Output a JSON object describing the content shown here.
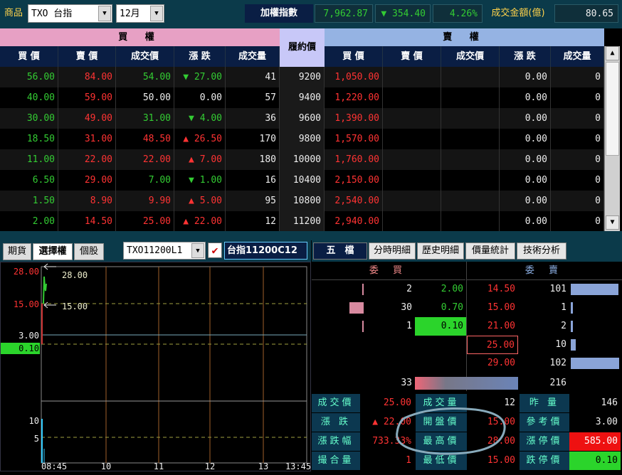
{
  "topbar": {
    "product_label": "商品",
    "product_value": "TXO 台指",
    "month_value": "12月",
    "index_label": "加權指數",
    "index_value": "7,962.87",
    "index_change": "▼ 354.40",
    "index_pct": "4.26%",
    "volume_label": "成交金額(億)",
    "volume_value": "80.65"
  },
  "table": {
    "buy_header": "買 權",
    "sell_header": "賣 權",
    "strike_header": "履約價",
    "columns": [
      "買 價",
      "賣 價",
      "成交價",
      "漲 跌",
      "成交量"
    ],
    "rows": [
      {
        "c_bid": "56.00",
        "c_ask": "84.00",
        "c_last": "54.00",
        "c_chg_dir": "down",
        "c_chg": "27.00",
        "c_vol": "41",
        "strike": "9200",
        "p_bid": "1,050.00",
        "p_ask": "",
        "p_last": "",
        "p_chg": "0.00",
        "p_vol": "0"
      },
      {
        "c_bid": "40.00",
        "c_ask": "59.00",
        "c_last": "50.00",
        "c_chg_dir": "none",
        "c_chg": "0.00",
        "c_vol": "57",
        "strike": "9400",
        "p_bid": "1,220.00",
        "p_ask": "",
        "p_last": "",
        "p_chg": "0.00",
        "p_vol": "0"
      },
      {
        "c_bid": "30.00",
        "c_ask": "49.00",
        "c_last": "31.00",
        "c_chg_dir": "down",
        "c_chg": "4.00",
        "c_vol": "36",
        "strike": "9600",
        "p_bid": "1,390.00",
        "p_ask": "",
        "p_last": "",
        "p_chg": "0.00",
        "p_vol": "0"
      },
      {
        "c_bid": "18.50",
        "c_ask": "31.00",
        "c_last": "48.50",
        "c_chg_dir": "up",
        "c_chg": "26.50",
        "c_vol": "170",
        "strike": "9800",
        "p_bid": "1,570.00",
        "p_ask": "",
        "p_last": "",
        "p_chg": "0.00",
        "p_vol": "0"
      },
      {
        "c_bid": "11.00",
        "c_ask": "22.00",
        "c_last": "22.00",
        "c_chg_dir": "up",
        "c_chg": "7.00",
        "c_vol": "180",
        "strike": "10000",
        "p_bid": "1,760.00",
        "p_ask": "",
        "p_last": "",
        "p_chg": "0.00",
        "p_vol": "0"
      },
      {
        "c_bid": "6.50",
        "c_ask": "29.00",
        "c_last": "7.00",
        "c_chg_dir": "down",
        "c_chg": "1.00",
        "c_vol": "16",
        "strike": "10400",
        "p_bid": "2,150.00",
        "p_ask": "",
        "p_last": "",
        "p_chg": "0.00",
        "p_vol": "0"
      },
      {
        "c_bid": "1.50",
        "c_ask": "8.90",
        "c_last": "9.90",
        "c_chg_dir": "up",
        "c_chg": "5.00",
        "c_vol": "95",
        "strike": "10800",
        "p_bid": "2,540.00",
        "p_ask": "",
        "p_last": "",
        "p_chg": "0.00",
        "p_vol": "0"
      },
      {
        "c_bid": "2.00",
        "c_ask": "14.50",
        "c_last": "25.00",
        "c_chg_dir": "up",
        "c_chg": "22.00",
        "c_vol": "12",
        "strike": "11200",
        "p_bid": "2,940.00",
        "p_ask": "",
        "p_last": "",
        "p_chg": "0.00",
        "p_vol": "0"
      }
    ]
  },
  "left_tabs": [
    "期貨",
    "選擇權",
    "個股"
  ],
  "left_tab_active": 1,
  "symbol_select": "TXO11200L1",
  "symbol_name": "台指11200C12",
  "right_tabs": [
    "五　檔",
    "分時明細",
    "歷史明細",
    "價量統計",
    "技術分析"
  ],
  "chart": {
    "y_labels": [
      "28.00",
      "15.00",
      "3.00",
      "0.10",
      "10",
      "5"
    ],
    "annotations": [
      "28.00",
      "15.00"
    ],
    "x_labels": [
      "08:45",
      "10",
      "11",
      "12",
      "13",
      "13:45"
    ]
  },
  "five": {
    "bid_header": "委 買",
    "ask_header": "委 賣",
    "levels": [
      {
        "bid_qty": "2",
        "bid_px": "2.00",
        "ask_px": "14.50",
        "ask_qty": "101"
      },
      {
        "bid_qty": "30",
        "bid_px": "0.70",
        "ask_px": "15.00",
        "ask_qty": "1"
      },
      {
        "bid_qty": "1",
        "bid_px": "0.10",
        "ask_px": "21.00",
        "ask_qty": "2"
      },
      {
        "bid_qty": "",
        "bid_px": "",
        "ask_px": "25.00",
        "ask_qty": "10"
      },
      {
        "bid_qty": "",
        "bid_px": "",
        "ask_px": "29.00",
        "ask_qty": "102"
      }
    ],
    "bid_total": "33",
    "ask_total": "216",
    "stats": [
      {
        "l1": "成交價",
        "v1": "25.00",
        "l2": "成交量",
        "v2": "12",
        "l3": "昨 量",
        "v3": "146"
      },
      {
        "l1": "漲 跌",
        "v1": "▲ 22.00",
        "l2": "開盤價",
        "v2": "15.00",
        "l3": "參考價",
        "v3": "3.00"
      },
      {
        "l1": "漲跌幅",
        "v1": "733.33%",
        "l2": "最高價",
        "v2": "28.00",
        "l3": "漲停價",
        "v3": "585.00"
      },
      {
        "l1": "撮合量",
        "v1": "1",
        "l2": "最低價",
        "v2": "15.00",
        "l3": "跌停價",
        "v3": "0.10"
      }
    ]
  }
}
